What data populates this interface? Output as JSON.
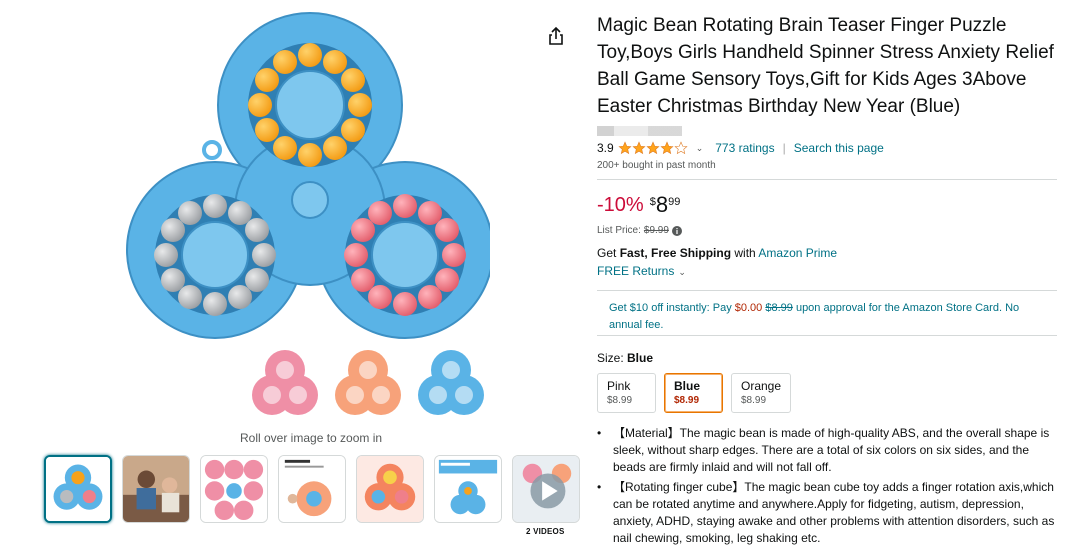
{
  "product": {
    "title": "Magic Bean Rotating Brain Teaser Finger Puzzle Toy,Boys Girls Handheld Spinner Stress Anxiety Relief Ball Game Sensory Toys,Gift for Kids Ages 3Above Easter Christmas Birthday New Year (Blue)",
    "rating_value": "3.9",
    "rating_stars": 3.9,
    "ratings_count": "773 ratings",
    "search_link": "Search this page",
    "bought": "200+ bought in past month"
  },
  "gallery": {
    "zoom_hint": "Roll over image to zoom in",
    "videos_label": "2 VIDEOS"
  },
  "pricing": {
    "discount": "-10%",
    "currency": "$",
    "whole": "8",
    "fraction": "99",
    "list_label": "List Price:",
    "list_price": "$9.99"
  },
  "shipping": {
    "prefix": "Get ",
    "bold": "Fast, Free Shipping",
    "with": " with ",
    "prime": "Amazon Prime",
    "returns": "FREE Returns"
  },
  "promo": {
    "part1": "Get $10 off instantly: Pay ",
    "pay": "$0.00",
    "struck": "$8.99",
    "part2": " upon approval for the Amazon Store Card. No annual fee."
  },
  "size": {
    "label": "Size: ",
    "value": "Blue"
  },
  "variants": [
    {
      "name": "Pink",
      "price": "$8.99"
    },
    {
      "name": "Blue",
      "price": "$8.99"
    },
    {
      "name": "Orange",
      "price": "$8.99"
    }
  ],
  "bullets": [
    "【Material】The magic bean is made of high-quality ABS, and the overall shape is sleek, without sharp edges. There are a total of six colors on six sides, and the beads are firmly inlaid and will not fall off.",
    "【Rotating finger cube】The magic bean cube toy adds a finger rotation axis,which can be rotated anytime and anywhere.Apply for fidgeting, autism, depression, anxiety, ADHD, staying awake and other problems with attention disorders, such as nail chewing, smoking, leg shaking etc."
  ],
  "colors": {
    "link": "#007185",
    "deal": "#cc0c39",
    "price_red": "#b12704",
    "star": "#ffa41c",
    "selected_border": "#e77600",
    "toy_blue": "#5ab3e6",
    "bead_orange": "#f7a21b",
    "bead_gray": "#b9bcbf",
    "bead_pink": "#ef7f8a"
  },
  "icons": [
    "share-icon",
    "star-icon",
    "chevron-down-icon",
    "info-icon",
    "play-icon"
  ]
}
